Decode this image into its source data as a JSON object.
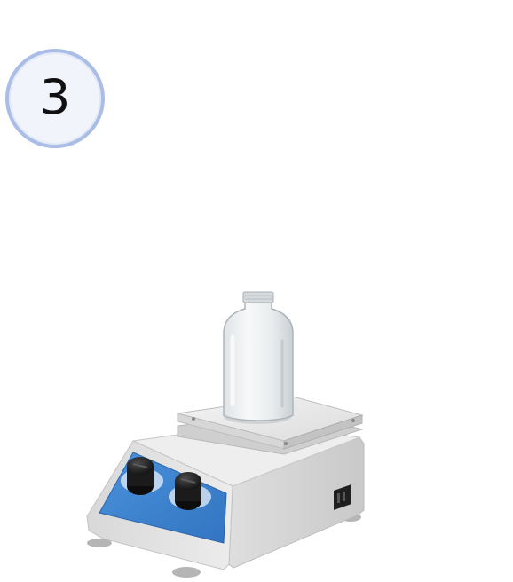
{
  "step": {
    "number": "3"
  },
  "illustration": {
    "subject": "magnetic-stirrer-hotplate-with-bottle",
    "knob_count": 2,
    "colors": {
      "badge_border": "#a9bde6",
      "badge_fill": "#f1f4fb",
      "control_panel": "#3f86d4",
      "body": "#e4e4e4",
      "knob": "#1e1e1e"
    }
  }
}
